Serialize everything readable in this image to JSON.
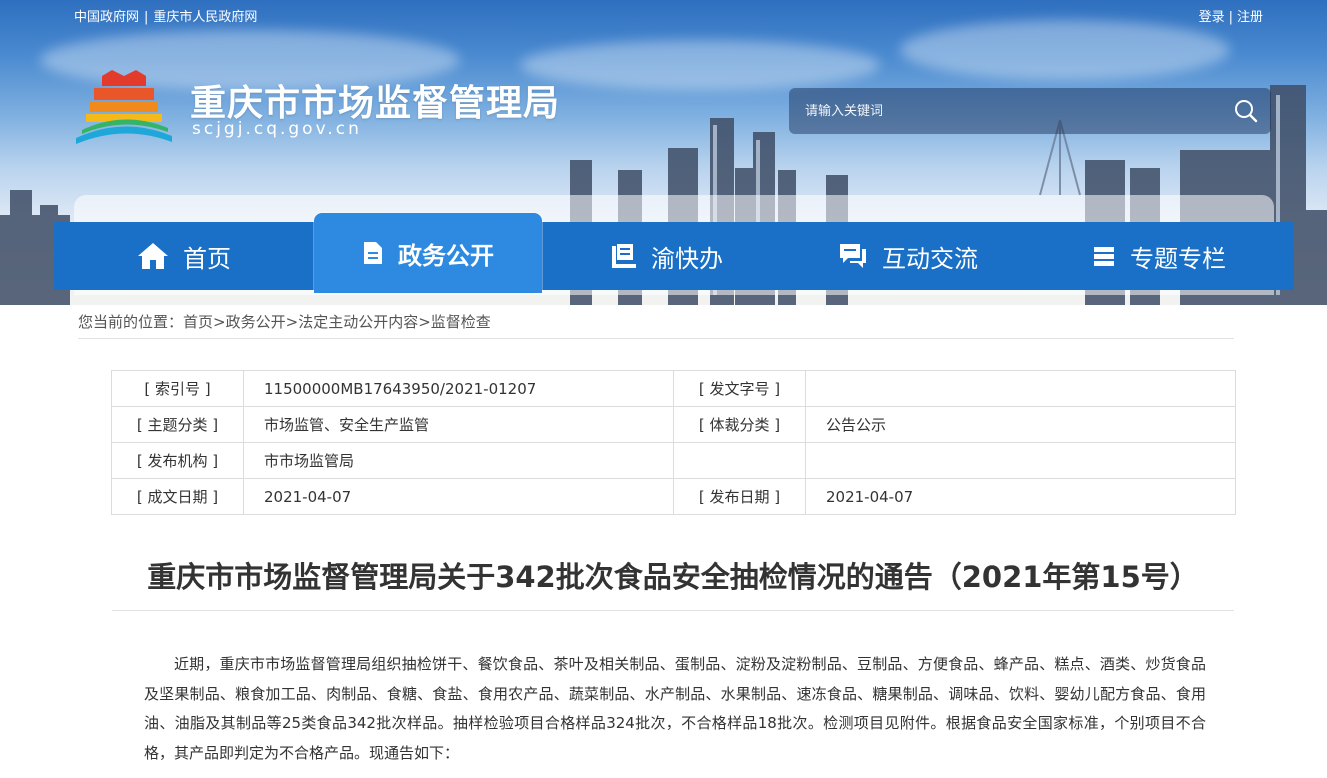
{
  "top_links": {
    "gov_portal": "中国政府网",
    "city_portal": "重庆市人民政府网",
    "separator": "|"
  },
  "account": {
    "login": "登录",
    "register": "注册",
    "separator": "|"
  },
  "site": {
    "title": "重庆市市场监督管理局",
    "domain": "scjgj.cq.gov.cn"
  },
  "search": {
    "placeholder": "请输入关键词"
  },
  "nav": {
    "items": [
      {
        "label": "首页",
        "icon": "home-icon"
      },
      {
        "label": "政务公开",
        "icon": "document-icon",
        "active": true
      },
      {
        "label": "渝快办",
        "icon": "service-desk-icon"
      },
      {
        "label": "互动交流",
        "icon": "chat-icon"
      },
      {
        "label": "专题专栏",
        "icon": "layers-icon"
      }
    ]
  },
  "breadcrumb": {
    "prefix": "您当前的位置：",
    "items": [
      "首页",
      "政务公开",
      "法定主动公开内容",
      "监督检查"
    ],
    "separator": ">"
  },
  "meta": {
    "index_no_label": "[ 索引号 ]",
    "index_no": "11500000MB17643950/2021-01207",
    "doc_no_label": "[ 发文字号 ]",
    "doc_no": "",
    "topic_label": "[ 主题分类 ]",
    "topic": "市场监管、安全生产监管",
    "genre_label": "[ 体裁分类 ]",
    "genre": "公告公示",
    "issuer_label": "[ 发布机构 ]",
    "issuer": "市市场监管局",
    "written_date_label": "[ 成文日期 ]",
    "written_date": "2021-04-07",
    "publish_date_label": "[ 发布日期 ]",
    "publish_date": "2021-04-07"
  },
  "article": {
    "title": "重庆市市场监督管理局关于342批次食品安全抽检情况的通告（2021年第15号）",
    "paragraph": "近期，重庆市市场监督管理局组织抽检饼干、餐饮食品、茶叶及相关制品、蛋制品、淀粉及淀粉制品、豆制品、方便食品、蜂产品、糕点、酒类、炒货食品及坚果制品、粮食加工品、肉制品、食糖、食盐、食用农产品、蔬菜制品、水产制品、水果制品、速冻食品、糖果制品、调味品、饮料、婴幼儿配方食品、食用油、油脂及其制品等25类食品342批次样品。抽样检验项目合格样品324批次，不合格样品18批次。检测项目见附件。根据食品安全国家标准，个别项目不合格，其产品即判定为不合格产品。现通告如下："
  },
  "colors": {
    "nav_bg": "#1a6fc6",
    "nav_active": "#2d8ae0"
  }
}
